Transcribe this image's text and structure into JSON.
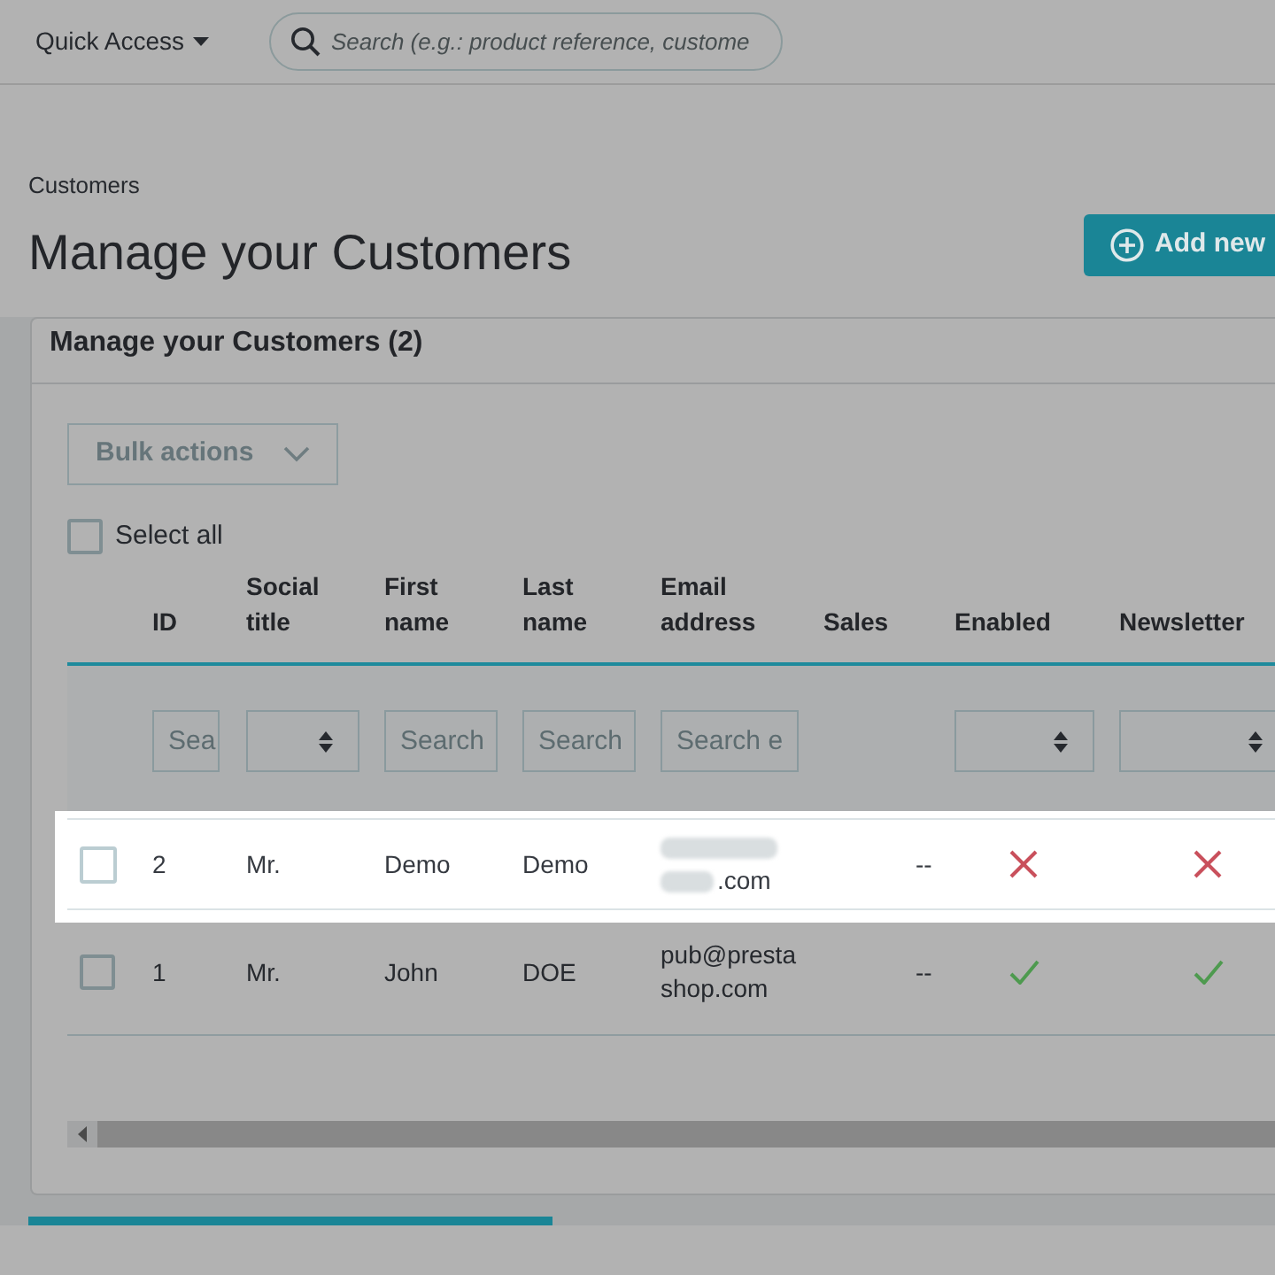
{
  "header": {
    "quick_access": "Quick Access",
    "search": {
      "placeholder": "Search (e.g.: product reference, custome"
    }
  },
  "breadcrumb": "Customers",
  "title": "Manage your Customers",
  "add_button": "Add new",
  "card": {
    "title": "Manage your Customers (2)",
    "bulk_actions": "Bulk actions",
    "select_all": {
      "label": "Select all",
      "checked": false
    },
    "columns": [
      {
        "label": "ID",
        "filter": {
          "kind": "input",
          "placeholder": "Sea"
        }
      },
      {
        "label": "Social title",
        "filter": {
          "kind": "select"
        }
      },
      {
        "label": "First name",
        "filter": {
          "kind": "input",
          "placeholder": "Search"
        }
      },
      {
        "label": "Last name",
        "filter": {
          "kind": "input",
          "placeholder": "Search"
        }
      },
      {
        "label": "Email address",
        "filter": {
          "kind": "input",
          "placeholder": "Search e"
        }
      },
      {
        "label": "Sales"
      },
      {
        "label": "Enabled",
        "filter": {
          "kind": "select"
        }
      },
      {
        "label": "Newsletter",
        "filter": {
          "kind": "select"
        }
      }
    ],
    "rows": [
      {
        "highlighted": true,
        "checked": false,
        "id": "2",
        "social_title": "Mr.",
        "first_name": "Demo",
        "last_name": "Demo",
        "email": {
          "text": ".com",
          "obscured": true
        },
        "sales": "--",
        "enabled": false,
        "newsletter": false
      },
      {
        "highlighted": false,
        "checked": false,
        "id": "1",
        "social_title": "Mr.",
        "first_name": "John",
        "last_name": "DOE",
        "email": {
          "text": "pub@prestashop.com",
          "obscured": false
        },
        "sales": "--",
        "enabled": true,
        "newsletter": true
      }
    ]
  }
}
